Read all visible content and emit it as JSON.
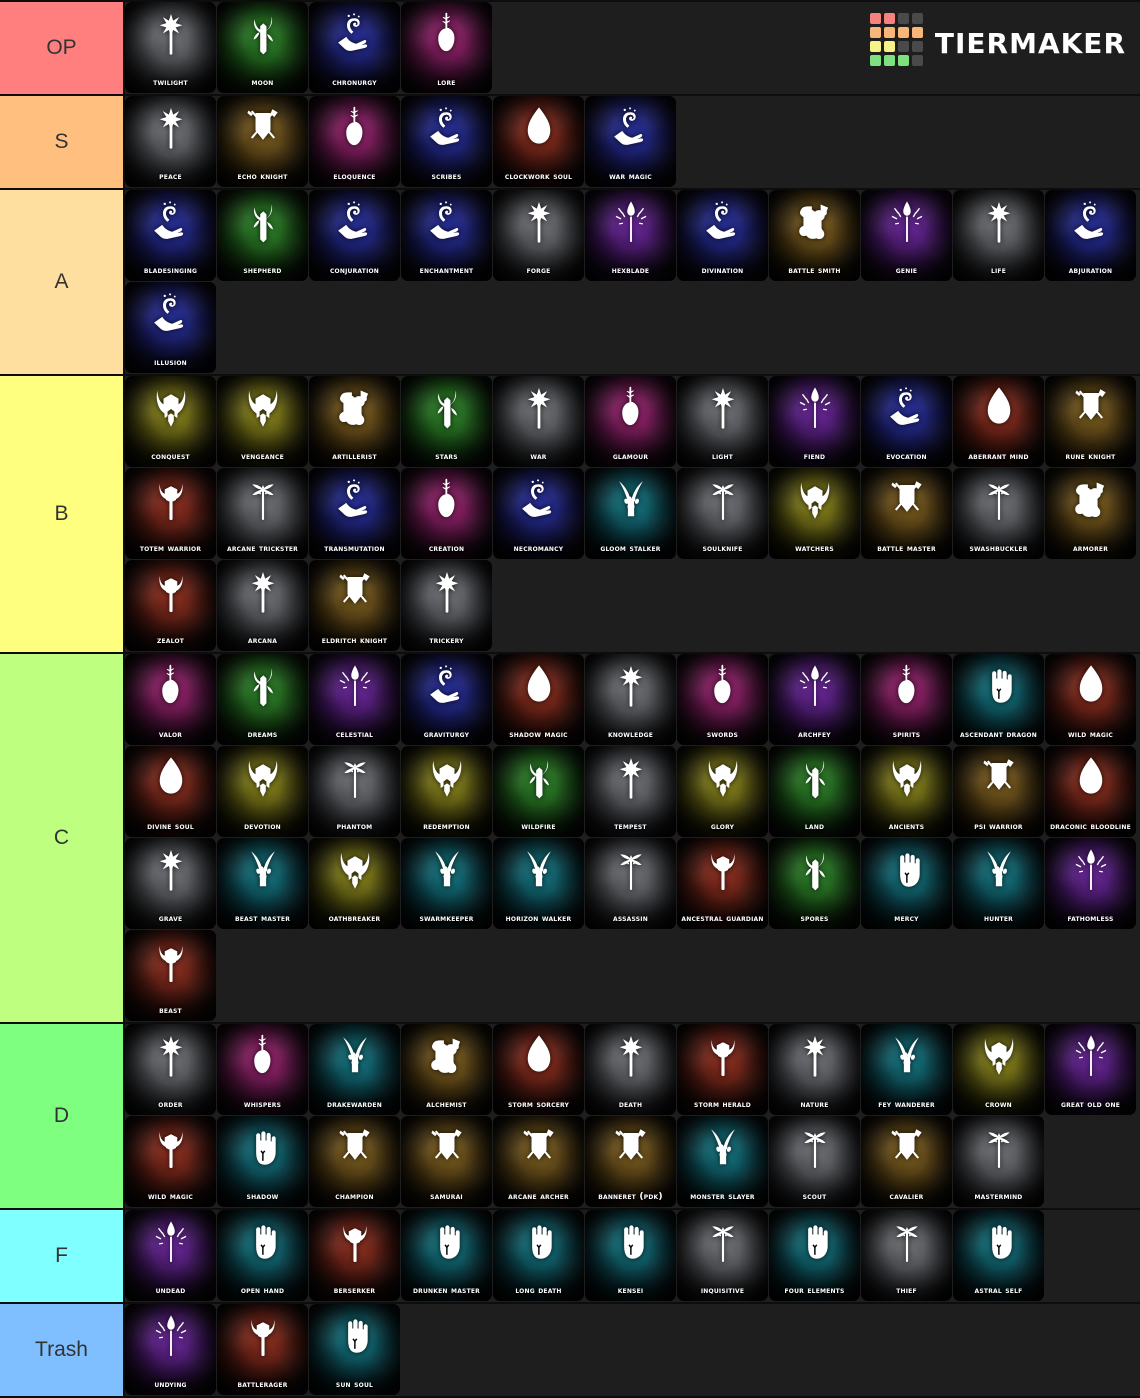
{
  "logo": {
    "word": "TierMaker",
    "cells": [
      "#f4837f",
      "#f4837f",
      "#4a4a4a",
      "#4a4a4a",
      "#f8b779",
      "#f8b779",
      "#f8b779",
      "#f8b779",
      "#f6f288",
      "#f6f288",
      "#4a4a4a",
      "#4a4a4a",
      "#7fe07f",
      "#7fe07f",
      "#7fe07f",
      "#4a4a4a"
    ]
  },
  "tiers": [
    {
      "label": "OP",
      "color": "#ff7f7f",
      "items": [
        {
          "name": "Twilight",
          "icon": "cleric-mace-icon",
          "hue": "gray"
        },
        {
          "name": "Moon",
          "icon": "druid-sickle-icon",
          "hue": "green"
        },
        {
          "name": "Chronurgy",
          "icon": "wizard-hand-icon",
          "hue": "blue"
        },
        {
          "name": "Lore",
          "icon": "bard-lute-icon",
          "hue": "magenta"
        }
      ]
    },
    {
      "label": "S",
      "color": "#ffbf7f",
      "items": [
        {
          "name": "Peace",
          "icon": "cleric-mace-icon",
          "hue": "gray"
        },
        {
          "name": "Echo Knight",
          "icon": "fighter-shield-icon",
          "hue": "brown"
        },
        {
          "name": "Eloquence",
          "icon": "bard-lute-icon",
          "hue": "magenta"
        },
        {
          "name": "Scribes",
          "icon": "wizard-hand-icon",
          "hue": "blue"
        },
        {
          "name": "Clockwork Soul",
          "icon": "sorcerer-flame-icon",
          "hue": "red"
        },
        {
          "name": "War Magic",
          "icon": "wizard-hand-icon",
          "hue": "blue"
        }
      ]
    },
    {
      "label": "A",
      "color": "#ffdf9f",
      "items": [
        {
          "name": "Bladesinging",
          "icon": "wizard-hand-icon",
          "hue": "blue"
        },
        {
          "name": "Shepherd",
          "icon": "druid-sickle-icon",
          "hue": "green"
        },
        {
          "name": "Conjuration",
          "icon": "wizard-hand-icon",
          "hue": "blue"
        },
        {
          "name": "Enchantment",
          "icon": "wizard-hand-icon",
          "hue": "blue"
        },
        {
          "name": "Forge",
          "icon": "cleric-mace-icon",
          "hue": "gray"
        },
        {
          "name": "Hexblade",
          "icon": "warlock-eye-icon",
          "hue": "purple"
        },
        {
          "name": "Divination",
          "icon": "wizard-hand-icon",
          "hue": "blue"
        },
        {
          "name": "Battle Smith",
          "icon": "artificer-flask-icon",
          "hue": "brown"
        },
        {
          "name": "Genie",
          "icon": "warlock-eye-icon",
          "hue": "purple"
        },
        {
          "name": "Life",
          "icon": "cleric-mace-icon",
          "hue": "gray"
        },
        {
          "name": "Abjuration",
          "icon": "wizard-hand-icon",
          "hue": "blue"
        },
        {
          "name": "Illusion",
          "icon": "wizard-hand-icon",
          "hue": "blue"
        }
      ]
    },
    {
      "label": "B",
      "color": "#ffff7f",
      "items": [
        {
          "name": "Conquest",
          "icon": "paladin-helm-icon",
          "hue": "olive"
        },
        {
          "name": "Vengeance",
          "icon": "paladin-helm-icon",
          "hue": "olive"
        },
        {
          "name": "Artillerist",
          "icon": "artificer-flask-icon",
          "hue": "brown"
        },
        {
          "name": "Stars",
          "icon": "druid-sickle-icon",
          "hue": "green"
        },
        {
          "name": "War",
          "icon": "cleric-mace-icon",
          "hue": "gray"
        },
        {
          "name": "Glamour",
          "icon": "bard-lute-icon",
          "hue": "magenta"
        },
        {
          "name": "Light",
          "icon": "cleric-mace-icon",
          "hue": "gray"
        },
        {
          "name": "Fiend",
          "icon": "warlock-eye-icon",
          "hue": "purple"
        },
        {
          "name": "Evocation",
          "icon": "wizard-hand-icon",
          "hue": "blue"
        },
        {
          "name": "Aberrant Mind",
          "icon": "sorcerer-flame-icon",
          "hue": "red"
        },
        {
          "name": "Rune Knight",
          "icon": "fighter-shield-icon",
          "hue": "brown"
        },
        {
          "name": "Totem Warrior",
          "icon": "barbarian-axe-icon",
          "hue": "red"
        },
        {
          "name": "Arcane Trickster",
          "icon": "rogue-dagger-icon",
          "hue": "gray"
        },
        {
          "name": "Transmutation",
          "icon": "wizard-hand-icon",
          "hue": "blue"
        },
        {
          "name": "Creation",
          "icon": "bard-lute-icon",
          "hue": "magenta"
        },
        {
          "name": "Necromancy",
          "icon": "wizard-hand-icon",
          "hue": "blue"
        },
        {
          "name": "Gloom Stalker",
          "icon": "ranger-paw-icon",
          "hue": "teal"
        },
        {
          "name": "Soulknife",
          "icon": "rogue-dagger-icon",
          "hue": "gray"
        },
        {
          "name": "Watchers",
          "icon": "paladin-helm-icon",
          "hue": "olive"
        },
        {
          "name": "Battle Master",
          "icon": "fighter-shield-icon",
          "hue": "brown"
        },
        {
          "name": "Swashbuckler",
          "icon": "rogue-dagger-icon",
          "hue": "gray"
        },
        {
          "name": "Armorer",
          "icon": "artificer-flask-icon",
          "hue": "brown"
        },
        {
          "name": "Zealot",
          "icon": "barbarian-axe-icon",
          "hue": "red"
        },
        {
          "name": "Arcana",
          "icon": "cleric-mace-icon",
          "hue": "gray"
        },
        {
          "name": "Eldritch Knight",
          "icon": "fighter-shield-icon",
          "hue": "brown"
        },
        {
          "name": "Trickery",
          "icon": "cleric-mace-icon",
          "hue": "gray"
        }
      ]
    },
    {
      "label": "C",
      "color": "#bfff7f",
      "items": [
        {
          "name": "Valor",
          "icon": "bard-lute-icon",
          "hue": "magenta"
        },
        {
          "name": "Dreams",
          "icon": "druid-sickle-icon",
          "hue": "green"
        },
        {
          "name": "Celestial",
          "icon": "warlock-eye-icon",
          "hue": "purple"
        },
        {
          "name": "Graviturgy",
          "icon": "wizard-hand-icon",
          "hue": "blue"
        },
        {
          "name": "Shadow Magic",
          "icon": "sorcerer-flame-icon",
          "hue": "red"
        },
        {
          "name": "Knowledge",
          "icon": "cleric-mace-icon",
          "hue": "gray"
        },
        {
          "name": "Swords",
          "icon": "bard-lute-icon",
          "hue": "magenta"
        },
        {
          "name": "Archfey",
          "icon": "warlock-eye-icon",
          "hue": "purple"
        },
        {
          "name": "Spirits",
          "icon": "bard-lute-icon",
          "hue": "magenta"
        },
        {
          "name": "Ascendant Dragon",
          "icon": "monk-fist-icon",
          "hue": "teal"
        },
        {
          "name": "Wild Magic",
          "icon": "sorcerer-flame-icon",
          "hue": "red"
        },
        {
          "name": "Divine Soul",
          "icon": "sorcerer-flame-icon",
          "hue": "red"
        },
        {
          "name": "Devotion",
          "icon": "paladin-helm-icon",
          "hue": "olive"
        },
        {
          "name": "Phantom",
          "icon": "rogue-dagger-icon",
          "hue": "gray"
        },
        {
          "name": "Redemption",
          "icon": "paladin-helm-icon",
          "hue": "olive"
        },
        {
          "name": "Wildfire",
          "icon": "druid-sickle-icon",
          "hue": "green"
        },
        {
          "name": "Tempest",
          "icon": "cleric-mace-icon",
          "hue": "gray"
        },
        {
          "name": "Glory",
          "icon": "paladin-helm-icon",
          "hue": "olive"
        },
        {
          "name": "Land",
          "icon": "druid-sickle-icon",
          "hue": "green"
        },
        {
          "name": "Ancients",
          "icon": "paladin-helm-icon",
          "hue": "olive"
        },
        {
          "name": "Psi Warrior",
          "icon": "fighter-shield-icon",
          "hue": "brown"
        },
        {
          "name": "Draconic Bloodline",
          "icon": "sorcerer-flame-icon",
          "hue": "red"
        },
        {
          "name": "Grave",
          "icon": "cleric-mace-icon",
          "hue": "gray"
        },
        {
          "name": "Beast Master",
          "icon": "ranger-paw-icon",
          "hue": "teal"
        },
        {
          "name": "Oathbreaker",
          "icon": "paladin-helm-icon",
          "hue": "olive"
        },
        {
          "name": "Swarmkeeper",
          "icon": "ranger-paw-icon",
          "hue": "teal"
        },
        {
          "name": "Horizon Walker",
          "icon": "ranger-paw-icon",
          "hue": "teal"
        },
        {
          "name": "Assassin",
          "icon": "rogue-dagger-icon",
          "hue": "gray"
        },
        {
          "name": "Ancestral Guardian",
          "icon": "barbarian-axe-icon",
          "hue": "red"
        },
        {
          "name": "Spores",
          "icon": "druid-sickle-icon",
          "hue": "green"
        },
        {
          "name": "Mercy",
          "icon": "monk-fist-icon",
          "hue": "teal"
        },
        {
          "name": "Hunter",
          "icon": "ranger-paw-icon",
          "hue": "teal"
        },
        {
          "name": "Fathomless",
          "icon": "warlock-eye-icon",
          "hue": "purple"
        },
        {
          "name": "Beast",
          "icon": "barbarian-axe-icon",
          "hue": "red"
        }
      ]
    },
    {
      "label": "D",
      "color": "#7fff7f",
      "items": [
        {
          "name": "Order",
          "icon": "cleric-mace-icon",
          "hue": "gray"
        },
        {
          "name": "Whispers",
          "icon": "bard-lute-icon",
          "hue": "magenta"
        },
        {
          "name": "Drakewarden",
          "icon": "ranger-paw-icon",
          "hue": "teal"
        },
        {
          "name": "Alchemist",
          "icon": "artificer-flask-icon",
          "hue": "brown"
        },
        {
          "name": "Storm Sorcery",
          "icon": "sorcerer-flame-icon",
          "hue": "red"
        },
        {
          "name": "Death",
          "icon": "cleric-mace-icon",
          "hue": "gray"
        },
        {
          "name": "Storm Herald",
          "icon": "barbarian-axe-icon",
          "hue": "red"
        },
        {
          "name": "Nature",
          "icon": "cleric-mace-icon",
          "hue": "gray"
        },
        {
          "name": "Fey Wanderer",
          "icon": "ranger-paw-icon",
          "hue": "teal"
        },
        {
          "name": "Crown",
          "icon": "paladin-helm-icon",
          "hue": "olive"
        },
        {
          "name": "Great Old One",
          "icon": "warlock-eye-icon",
          "hue": "purple"
        },
        {
          "name": "Wild Magic",
          "icon": "barbarian-axe-icon",
          "hue": "red"
        },
        {
          "name": "Shadow",
          "icon": "monk-fist-icon",
          "hue": "teal"
        },
        {
          "name": "Champion",
          "icon": "fighter-shield-icon",
          "hue": "brown"
        },
        {
          "name": "Samurai",
          "icon": "fighter-shield-icon",
          "hue": "brown"
        },
        {
          "name": "Arcane Archer",
          "icon": "fighter-shield-icon",
          "hue": "brown"
        },
        {
          "name": "Banneret (PDK)",
          "icon": "fighter-shield-icon",
          "hue": "brown"
        },
        {
          "name": "Monster Slayer",
          "icon": "ranger-paw-icon",
          "hue": "teal"
        },
        {
          "name": "Scout",
          "icon": "rogue-dagger-icon",
          "hue": "gray"
        },
        {
          "name": "Cavalier",
          "icon": "fighter-shield-icon",
          "hue": "brown"
        },
        {
          "name": "Mastermind",
          "icon": "rogue-dagger-icon",
          "hue": "gray"
        }
      ]
    },
    {
      "label": "F",
      "color": "#7fffff",
      "items": [
        {
          "name": "Undead",
          "icon": "warlock-eye-icon",
          "hue": "purple"
        },
        {
          "name": "Open Hand",
          "icon": "monk-fist-icon",
          "hue": "teal"
        },
        {
          "name": "Berserker",
          "icon": "barbarian-axe-icon",
          "hue": "red"
        },
        {
          "name": "Drunken Master",
          "icon": "monk-fist-icon",
          "hue": "teal"
        },
        {
          "name": "Long Death",
          "icon": "monk-fist-icon",
          "hue": "teal"
        },
        {
          "name": "Kensei",
          "icon": "monk-fist-icon",
          "hue": "teal"
        },
        {
          "name": "Inquisitive",
          "icon": "rogue-dagger-icon",
          "hue": "gray"
        },
        {
          "name": "Four Elements",
          "icon": "monk-fist-icon",
          "hue": "teal"
        },
        {
          "name": "Thief",
          "icon": "rogue-dagger-icon",
          "hue": "gray"
        },
        {
          "name": "Astral Self",
          "icon": "monk-fist-icon",
          "hue": "teal"
        }
      ]
    },
    {
      "label": "Trash",
      "color": "#7fbfff",
      "items": [
        {
          "name": "Undying",
          "icon": "warlock-eye-icon",
          "hue": "purple"
        },
        {
          "name": "Battlerager",
          "icon": "barbarian-axe-icon",
          "hue": "red"
        },
        {
          "name": "Sun Soul",
          "icon": "monk-fist-icon",
          "hue": "teal"
        }
      ]
    }
  ]
}
